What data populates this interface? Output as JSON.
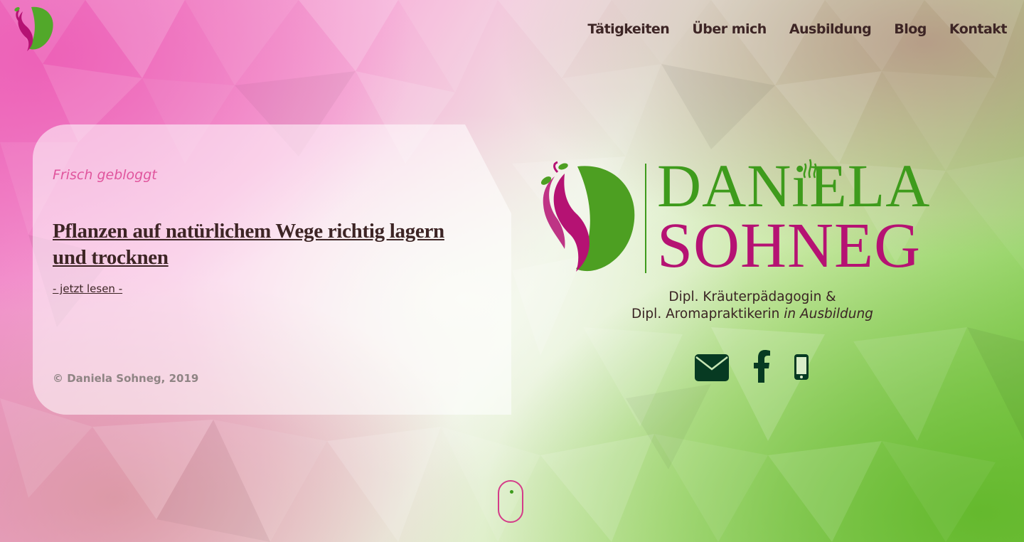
{
  "nav": {
    "items": [
      {
        "label": "Tätigkeiten"
      },
      {
        "label": "Über mich"
      },
      {
        "label": "Ausbildung"
      },
      {
        "label": "Blog"
      },
      {
        "label": "Kontakt"
      }
    ]
  },
  "featured_post": {
    "kicker": "Frisch gebloggt",
    "title": "Pflanzen auf natürlichem Wege richtig lagern und trocknen",
    "read_more": "- jetzt lesen -",
    "copyright": "© Daniela Sohneg, 2019"
  },
  "brand": {
    "first_name": "DANiELA",
    "last_name": "SOHNEG",
    "subtitle_line1": "Dipl. Kräuterpädagogin &",
    "subtitle_line2": "Dipl. Aromapraktikerin ",
    "subtitle_line2_italic": "in Ausbildung"
  },
  "contact_icons": [
    "envelope-icon",
    "facebook-icon",
    "mobile-phone-icon"
  ],
  "colors": {
    "green": "#3e9b1c",
    "magenta": "#b51273",
    "pink": "#e0559d",
    "dark_text": "#3d2525",
    "icon_dark_green": "#073a22"
  }
}
